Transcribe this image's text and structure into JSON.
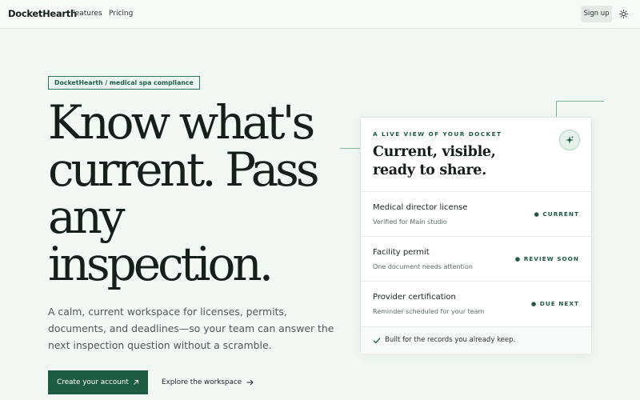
{
  "nav": {
    "brand": "DocketHearth",
    "links": [
      "Features",
      "Pricing"
    ],
    "signup": "Sign up",
    "theme_icon": "sun-icon"
  },
  "hero": {
    "tagline": "DocketHearth / medical spa compliance",
    "title": "Know what's current. Pass any inspection.",
    "subtitle": "A calm, current workspace for licenses, permits, documents, and deadlines—so your team can answer the next inspection question without a scramble.",
    "cta_primary": "Create your account",
    "cta_primary_icon": "arrow-up-right-icon",
    "cta_secondary": "Explore the workspace",
    "cta_secondary_icon": "arrow-right-icon"
  },
  "card": {
    "eyebrow": "A LIVE VIEW OF YOUR DOCKET",
    "title": "Current, visible, ready to share.",
    "badge_icon": "sparkle-icon",
    "rows": [
      {
        "title": "Medical director license",
        "sub": "Verified for Main studio",
        "status": "● CURRENT"
      },
      {
        "title": "Facility permit",
        "sub": "One document needs attention",
        "status": "● REVIEW SOON"
      },
      {
        "title": "Provider certification",
        "sub": "Reminder scheduled for your team",
        "status": "● DUE NEXT"
      }
    ],
    "footer": "Built for the records you already keep.",
    "footer_icon": "check-icon"
  },
  "colors": {
    "background": "#f2f8f4",
    "accent": "#1e5c42",
    "status": "#1e5a40"
  }
}
